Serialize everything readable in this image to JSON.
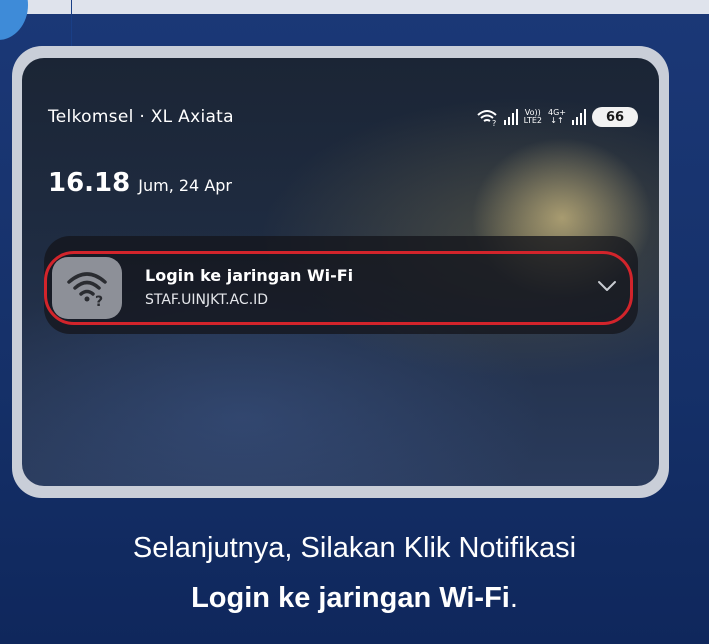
{
  "status_bar": {
    "carrier": "Telkomsel · XL Axiata",
    "volte_top": "Vo))",
    "volte_bottom": "LTE2",
    "network_top": "4G+",
    "network_bottom": "↓↑",
    "battery": "66"
  },
  "clock": {
    "time": "16.18",
    "date": "Jum, 24 Apr"
  },
  "notification": {
    "title": "Login ke jaringan Wi-Fi",
    "subtitle": "STAF.UINJKT.AC.ID",
    "icon": "wifi-question-icon",
    "expand_icon": "chevron-down-icon",
    "highlight_color": "#d2242b"
  },
  "caption": {
    "line1": "Selanjutnya, Silakan Klik Notifikasi",
    "line2_bold": "Login ke jaringan Wi-Fi",
    "line2_suffix": "."
  },
  "colors": {
    "background": "#16306a",
    "accent_circle": "#3e8bd8",
    "highlight": "#d2242b"
  }
}
